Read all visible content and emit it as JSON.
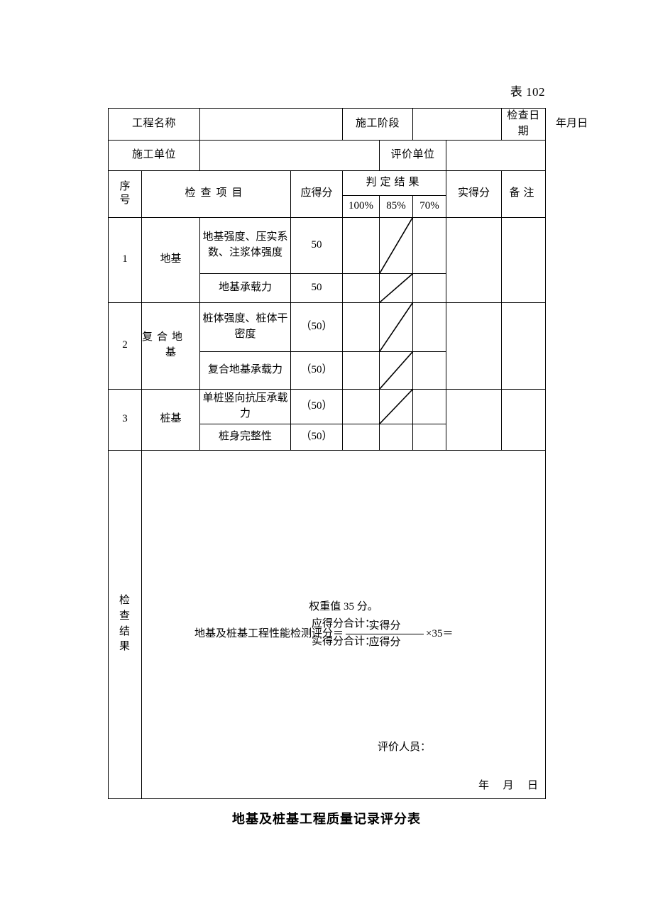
{
  "table_number": "表 102",
  "header": {
    "project_name_label": "工程名称",
    "project_name_value": "",
    "construction_stage_label": "施工阶段",
    "construction_stage_value": "",
    "inspection_date_label": "检查日期",
    "date_year": "年",
    "date_month": "月",
    "date_day": "日",
    "construction_unit_label": "施工单位",
    "construction_unit_value": "",
    "evaluation_unit_label": "评价单位",
    "evaluation_unit_value": ""
  },
  "columns": {
    "seq_line1": "序",
    "seq_line2": "号",
    "inspection_item": "检查项目",
    "due_score": "应得分",
    "judgement_result": "判定结果",
    "pct_100": "100%",
    "pct_85": "85%",
    "pct_70": "70%",
    "actual_score": "实得分",
    "remarks": "备注"
  },
  "rows": [
    {
      "seq": "1",
      "group": "地基",
      "group_wrap": false,
      "items": [
        {
          "name": "地基强度、压实系数、注浆体强度",
          "due": "50",
          "slash_85": true
        },
        {
          "name": "地基承载力",
          "due": "50",
          "slash_85": true
        }
      ]
    },
    {
      "seq": "2",
      "group": "复合地基",
      "group_wrap": true,
      "group_line1": "复合地",
      "group_line2": "基",
      "items": [
        {
          "name": "桩体强度、桩体干密度",
          "due": "（50）",
          "slash_85": true
        },
        {
          "name": "复合地基承载力",
          "due": "（50）",
          "slash_85": true
        }
      ]
    },
    {
      "seq": "3",
      "group": "桩基",
      "group_wrap": false,
      "items": [
        {
          "name": "单桩竖向抗压承载力",
          "due": "（50）",
          "slash_85": true
        },
        {
          "name": "桩身完整性",
          "due": "（50）",
          "slash_85": false
        }
      ]
    }
  ],
  "result": {
    "label_chars": [
      "检",
      "查",
      "结",
      "果"
    ],
    "line1": "权重值 35 分。",
    "line2": "应得分合计：",
    "line3": "实得分合计：",
    "formula_prefix": "地基及桩基工程性能检测评分＝",
    "formula_numerator": "实得分",
    "formula_denominator": "应得分",
    "formula_suffix": "×35＝",
    "evaluator_label": "评价人员：",
    "date_year": "年",
    "date_month": "月",
    "date_day": "日"
  },
  "doc_title": "地基及桩基工程质量记录评分表"
}
